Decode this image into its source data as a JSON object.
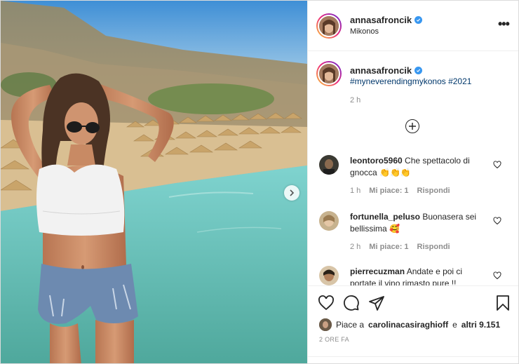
{
  "post": {
    "username": "annasafroncik",
    "location": "Mikonos",
    "caption_tags": "#myneverendingmykonos #2021",
    "caption_time": "2 h"
  },
  "comments": [
    {
      "username": "leontoro5960",
      "text": "Che spettacolo di gnocca 👏👏👏",
      "time": "1 h",
      "likes": "Mi piace: 1",
      "reply": "Rispondi"
    },
    {
      "username": "fortunella_peluso",
      "text": "Buonasera sei bellissima 🥰",
      "time": "2 h",
      "likes": "Mi piace: 1",
      "reply": "Rispondi"
    },
    {
      "username": "pierrecuzman",
      "text": "Andate e poi ci portate il vino rimasto pure !!"
    }
  ],
  "likes": {
    "prefix": "Piace a",
    "user": "carolinacasiraghioff",
    "middle": "e",
    "others": "altri 9.151"
  },
  "timestamp": "2 ORE FA",
  "icons": {
    "more": "more-options-icon",
    "next": "chevron-right-icon",
    "like": "heart-icon",
    "comment": "comment-icon",
    "share": "share-icon",
    "save": "bookmark-icon",
    "verified": "verified-badge-icon",
    "load_more": "plus-circle-icon"
  },
  "colors": {
    "verified": "#3897f0",
    "hashtag": "#00376b",
    "muted": "#8e8e8e",
    "text": "#262626"
  }
}
